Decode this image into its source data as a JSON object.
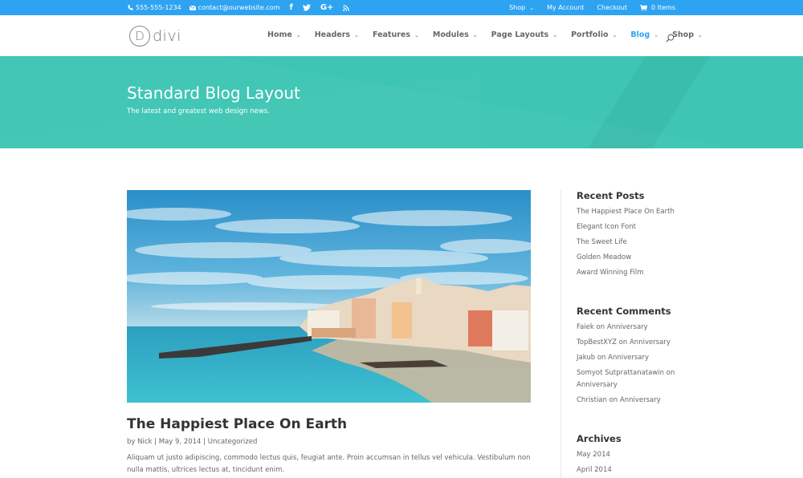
{
  "topbar": {
    "phone": "555-555-1234",
    "email": "contact@ourwebsite.com",
    "social": [
      "facebook-icon",
      "twitter-icon",
      "google-plus-icon",
      "rss-icon"
    ],
    "google_plus_label": "G+",
    "facebook_label": "f",
    "links": {
      "shop": "Shop",
      "account": "My Account",
      "checkout": "Checkout",
      "cart": "0 Items"
    }
  },
  "header": {
    "logo_letter": "D",
    "logo_text": "divi",
    "nav": [
      {
        "label": "Home",
        "active": false
      },
      {
        "label": "Headers",
        "active": false
      },
      {
        "label": "Features",
        "active": false
      },
      {
        "label": "Modules",
        "active": false
      },
      {
        "label": "Page Layouts",
        "active": false
      },
      {
        "label": "Portfolio",
        "active": false
      },
      {
        "label": "Blog",
        "active": true
      },
      {
        "label": "Shop",
        "active": false
      }
    ],
    "chevron": "⌄"
  },
  "hero": {
    "title": "Standard Blog Layout",
    "subtitle": "The latest and greatest web design news."
  },
  "post": {
    "image_alt": "Coastal town with colorful buildings by the sea",
    "title": "The Happiest Place On Earth",
    "meta_prefix": "by",
    "author": "Nick",
    "separator": "|",
    "date": "May 9, 2014",
    "category": "Uncategorized",
    "excerpt": "Aliquam ut justo adipiscing, commodo lectus quis, feugiat ante. Proin accumsan in tellus vel vehicula. Vestibulum non nulla mattis, ultrices lectus at, tincidunt enim."
  },
  "sidebar": {
    "recent_posts": {
      "title": "Recent Posts",
      "items": [
        "The Happiest Place On Earth",
        "Elegant Icon Font",
        "The Sweet Life",
        "Golden Meadow",
        "Award Winning Film"
      ]
    },
    "recent_comments": {
      "title": "Recent Comments",
      "items": [
        "Faiek on Anniversary",
        "TopBestXYZ on Anniversary",
        "Jakub on Anniversary",
        "Somyot Sutprattanatawin on Anniversary",
        "Christian on Anniversary"
      ]
    },
    "archives": {
      "title": "Archives",
      "items": [
        "May 2014",
        "April 2014"
      ]
    }
  },
  "colors": {
    "accent": "#2ea3f2",
    "hero": "#3ec5b4"
  }
}
